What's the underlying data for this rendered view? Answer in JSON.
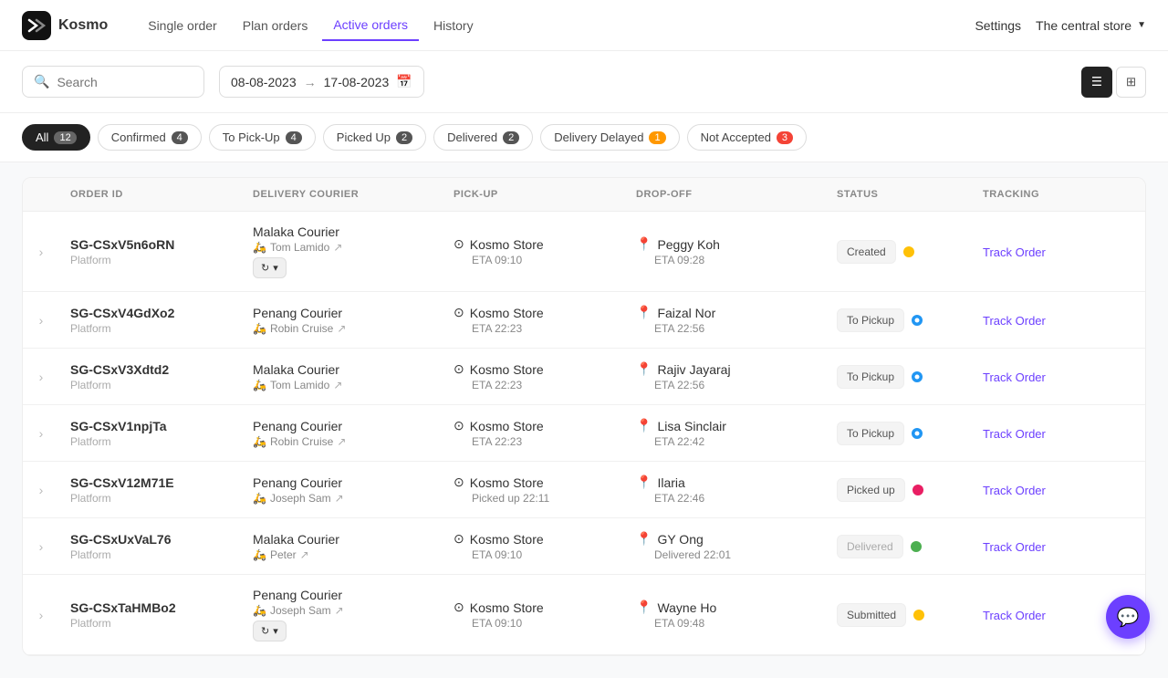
{
  "brand": {
    "name": "Kosmo"
  },
  "nav": {
    "links": [
      {
        "label": "Single order",
        "active": false
      },
      {
        "label": "Plan orders",
        "active": false
      },
      {
        "label": "Active orders",
        "active": true
      },
      {
        "label": "History",
        "active": false
      }
    ],
    "settings": "Settings",
    "store": "The central store"
  },
  "toolbar": {
    "search_placeholder": "Search",
    "date_from": "08-08-2023",
    "date_to": "17-08-2023"
  },
  "filter_tabs": [
    {
      "label": "All",
      "count": "12",
      "active": true,
      "badge_class": ""
    },
    {
      "label": "Confirmed",
      "count": "4",
      "active": false,
      "badge_class": ""
    },
    {
      "label": "To Pick-Up",
      "count": "4",
      "active": false,
      "badge_class": ""
    },
    {
      "label": "Picked Up",
      "count": "2",
      "active": false,
      "badge_class": ""
    },
    {
      "label": "Delivered",
      "count": "2",
      "active": false,
      "badge_class": ""
    },
    {
      "label": "Delivery Delayed",
      "count": "1",
      "active": false,
      "badge_class": "badge-orange"
    },
    {
      "label": "Not Accepted",
      "count": "3",
      "active": false,
      "badge_class": "badge-red"
    }
  ],
  "table": {
    "headers": [
      "",
      "ORDER ID",
      "DELIVERY COURIER",
      "PICK-UP",
      "DROP-OFF",
      "STATUS",
      "TRACKING"
    ],
    "rows": [
      {
        "id": "SG-CSxV5n6oRN",
        "sub": "Platform",
        "courier": "Malaka Courier",
        "courier_person": "Tom Lamido",
        "has_sync": true,
        "pickup": "Kosmo Store",
        "pickup_eta": "ETA 09:10",
        "dropoff": "Peggy Koh",
        "dropoff_eta": "ETA 09:28",
        "status": "Created",
        "status_dot": "dot-yellow",
        "tracking": "Track Order"
      },
      {
        "id": "SG-CSxV4GdXo2",
        "sub": "Platform",
        "courier": "Penang Courier",
        "courier_person": "Robin Cruise",
        "has_sync": false,
        "pickup": "Kosmo Store",
        "pickup_eta": "ETA 22:23",
        "dropoff": "Faizal Nor",
        "dropoff_eta": "ETA 22:56",
        "status": "To Pickup",
        "status_dot": "dot-blue",
        "tracking": "Track Order"
      },
      {
        "id": "SG-CSxV3Xdtd2",
        "sub": "Platform",
        "courier": "Malaka Courier",
        "courier_person": "Tom Lamido",
        "has_sync": false,
        "pickup": "Kosmo Store",
        "pickup_eta": "ETA 22:23",
        "dropoff": "Rajiv Jayaraj",
        "dropoff_eta": "ETA 22:56",
        "status": "To Pickup",
        "status_dot": "dot-blue",
        "tracking": "Track Order"
      },
      {
        "id": "SG-CSxV1npjTa",
        "sub": "Platform",
        "courier": "Penang Courier",
        "courier_person": "Robin Cruise",
        "has_sync": false,
        "pickup": "Kosmo Store",
        "pickup_eta": "ETA 22:23",
        "dropoff": "Lisa Sinclair",
        "dropoff_eta": "ETA 22:42",
        "status": "To Pickup",
        "status_dot": "dot-blue",
        "tracking": "Track Order"
      },
      {
        "id": "SG-CSxV12M71E",
        "sub": "Platform",
        "courier": "Penang Courier",
        "courier_person": "Joseph Sam",
        "has_sync": false,
        "pickup": "Kosmo Store",
        "pickup_eta": "Picked up 22:11",
        "dropoff": "Ilaria",
        "dropoff_eta": "ETA 22:46",
        "status": "Picked up",
        "status_dot": "dot-pink",
        "tracking": "Track Order"
      },
      {
        "id": "SG-CSxUxVaL76",
        "sub": "Platform",
        "courier": "Malaka Courier",
        "courier_person": "Peter",
        "has_sync": false,
        "pickup": "Kosmo Store",
        "pickup_eta": "ETA 09:10",
        "dropoff": "GY Ong",
        "dropoff_eta": "Delivered 22:01",
        "status": "Delivered",
        "status_dot": "dot-green",
        "tracking": "Track Order"
      },
      {
        "id": "SG-CSxTaHMBo2",
        "sub": "Platform",
        "courier": "Penang Courier",
        "courier_person": "Joseph Sam",
        "has_sync": true,
        "pickup": "Kosmo Store",
        "pickup_eta": "ETA 09:10",
        "dropoff": "Wayne Ho",
        "dropoff_eta": "ETA 09:48",
        "status": "Submitted",
        "status_dot": "dot-yellow",
        "tracking": "Track Order"
      }
    ]
  }
}
